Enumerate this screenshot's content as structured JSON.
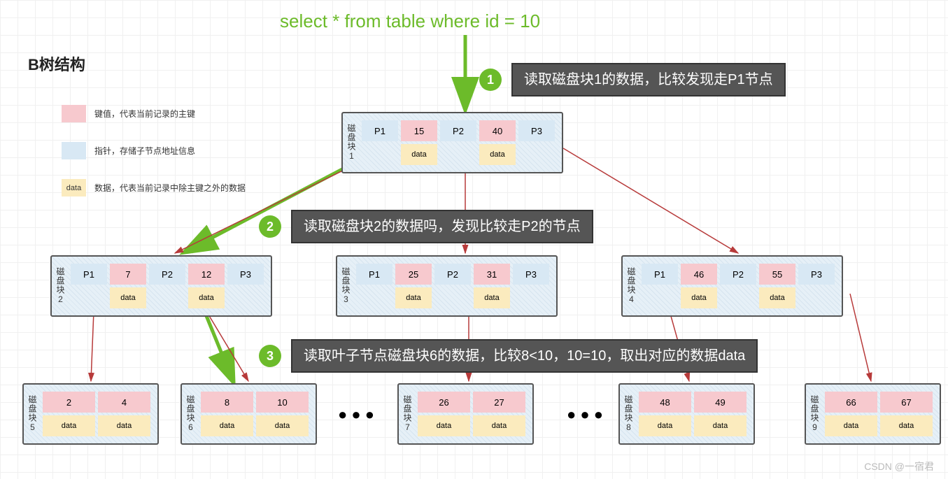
{
  "title": "B树结构",
  "sql": "select * from table where id = 10",
  "legend": {
    "key": "键值，代表当前记录的主键",
    "ptr": "指针，存储子节点地址信息",
    "data": "数据，代表当前记录中除主键之外的数据",
    "data_swatch": "data"
  },
  "steps": {
    "s1": {
      "num": "1",
      "text": "读取磁盘块1的数据，比较发现走P1节点"
    },
    "s2": {
      "num": "2",
      "text": "读取磁盘块2的数据吗，发现比较走P2的节点"
    },
    "s3": {
      "num": "3",
      "text": "读取叶子节点磁盘块6的数据，比较8<10，10=10，取出对应的数据data"
    }
  },
  "labels": {
    "block_prefix": "磁盘块",
    "p1": "P1",
    "p2": "P2",
    "p3": "P3",
    "data": "data"
  },
  "blocks": {
    "b1": {
      "num": "1",
      "k1": "15",
      "k2": "40"
    },
    "b2": {
      "num": "2",
      "k1": "7",
      "k2": "12"
    },
    "b3": {
      "num": "3",
      "k1": "25",
      "k2": "31"
    },
    "b4": {
      "num": "4",
      "k1": "46",
      "k2": "55"
    },
    "b5": {
      "num": "5",
      "v1": "2",
      "v2": "4"
    },
    "b6": {
      "num": "6",
      "v1": "8",
      "v2": "10"
    },
    "b7": {
      "num": "7",
      "v1": "26",
      "v2": "27"
    },
    "b8": {
      "num": "8",
      "v1": "48",
      "v2": "49"
    },
    "b9": {
      "num": "9",
      "v1": "66",
      "v2": "67"
    }
  },
  "dots": "● ● ●",
  "watermark": "CSDN @一宿君",
  "colors": {
    "green": "#6cbb2a",
    "red": "#b73a3a"
  }
}
